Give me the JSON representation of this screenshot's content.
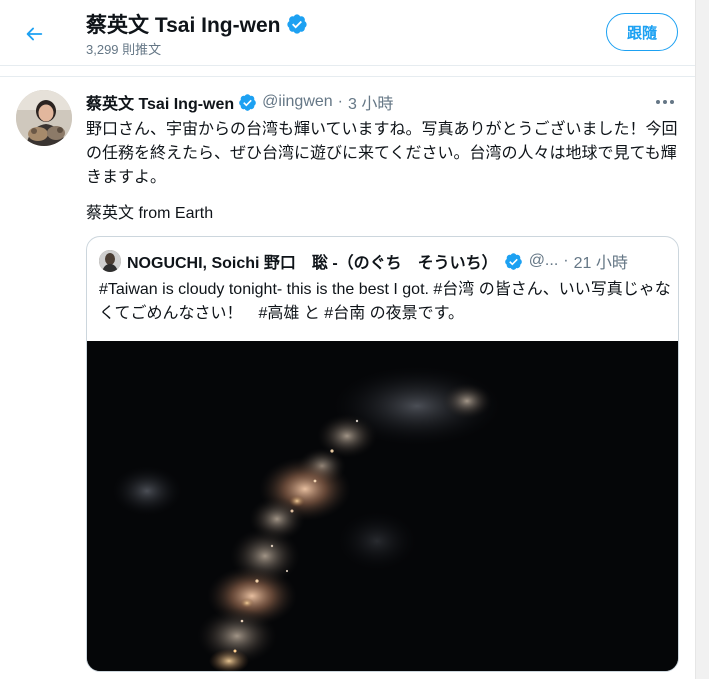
{
  "header": {
    "name": "蔡英文 Tsai Ing-wen",
    "tweet_count": "3,299 則推文",
    "follow_label": "跟隨"
  },
  "tweet": {
    "name": "蔡英文 Tsai Ing-wen",
    "handle": "@iingwen",
    "separator": "·",
    "time": "3 小時",
    "text": "野口さん、宇宙からの台湾も輝いていますね。写真ありがとうございました！今回の任務を終えたら、ぜひ台湾に遊びに来てください。台湾の人々は地球で見ても輝きますよ。",
    "signature": "蔡英文 from Earth"
  },
  "quote": {
    "name": "NOGUCHI, Soichi 野口　聡 -（のぐち　そういち）",
    "handle": "@...",
    "separator": "·",
    "time": "21 小時",
    "text": "#Taiwan is cloudy tonight- this is the best I got. #台湾 の皆さん、いい写真じゃなくてごめんなさい！　#高雄 と #台南 の夜景です。"
  },
  "colors": {
    "accent": "#1da1f2",
    "text": "#0f1419",
    "muted": "#657786",
    "border": "#ccd6dd"
  }
}
